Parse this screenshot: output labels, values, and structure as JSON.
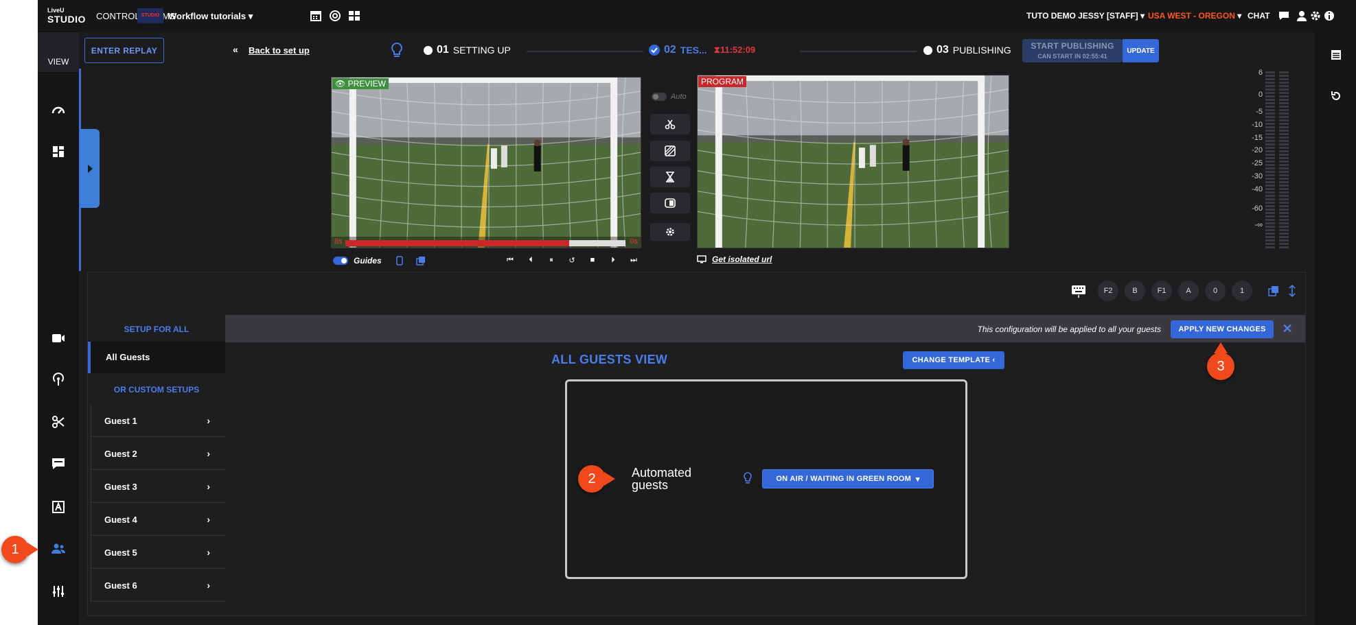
{
  "topbar": {
    "logo_top": "LiveU",
    "logo_main": "STUDIO",
    "control_rooms": "CONTROL ROOMS",
    "workspace_badge": "STUDIO",
    "workspace_name": "Workflow tutorials",
    "user": "TUTO DEMO JESSY [STAFF]",
    "region": "USA WEST - OREGON",
    "chat": "CHAT"
  },
  "left_rail": {
    "view_label": "VIEW",
    "icons": [
      "dashboard-icon",
      "layout-icon",
      "camera-icon",
      "broadcast-icon",
      "scissors-icon",
      "message-icon",
      "text-icon",
      "guests-icon",
      "mixer-icon"
    ]
  },
  "workflow": {
    "enter_replay": "ENTER REPLAY",
    "back_to_setup": "Back to set up",
    "step1_num": "01",
    "step1_label": "SETTING UP",
    "step2_num": "02",
    "step2_label": "TES...",
    "step2_timer": "11:52:09",
    "step3_num": "03",
    "step3_label": "PUBLISHING",
    "start_publishing": "START PUBLISHING",
    "can_start": "CAN START IN 02:55:41",
    "update": "UPDATE"
  },
  "preview": {
    "label": "PREVIEW",
    "start_label": "8s",
    "end_label": "0s",
    "progress": 0.8
  },
  "program": {
    "label": "PROGRAM",
    "isolated_url": "Get isolated url"
  },
  "controls": {
    "auto": "Auto",
    "guides": "Guides"
  },
  "meter": {
    "scale": [
      "6",
      "0",
      "-5",
      "-10",
      "-15",
      "-20",
      "-25",
      "-30",
      "-40",
      "-60",
      "-∞"
    ]
  },
  "shortcuts": [
    "F2",
    "B",
    "F1",
    "A",
    "0",
    "1"
  ],
  "setup": {
    "notice": "This configuration will be applied to all your guests",
    "apply": "APPLY NEW CHANGES",
    "setup_for_all": "SETUP FOR ALL",
    "all_guests": "All Guests",
    "custom_setups": "OR CUSTOM SETUPS",
    "guests": [
      "Guest 1",
      "Guest 2",
      "Guest 3",
      "Guest 4",
      "Guest 5",
      "Guest 6"
    ],
    "view_title": "ALL GUESTS VIEW",
    "change_template": "CHANGE TEMPLATE",
    "automated_line1": "Automated",
    "automated_line2": "guests",
    "on_air": "ON AIR / WAITING IN GREEN ROOM"
  },
  "callouts": [
    "1",
    "2",
    "3"
  ],
  "colors": {
    "accent": "#3468d8",
    "callout": "#f04a1c",
    "region": "#ff5a1f",
    "timer": "#e0393b"
  }
}
